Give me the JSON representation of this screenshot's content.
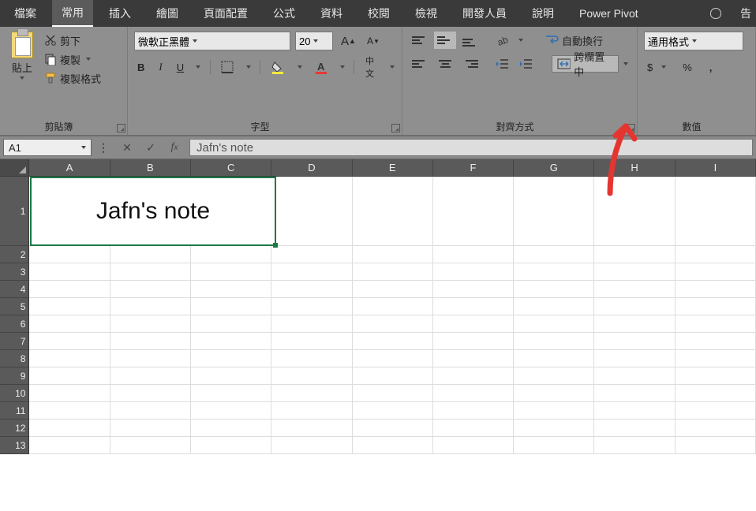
{
  "menu": {
    "items": [
      "檔案",
      "常用",
      "插入",
      "繪圖",
      "頁面配置",
      "公式",
      "資料",
      "校閱",
      "檢視",
      "開發人員",
      "說明",
      "Power Pivot"
    ],
    "active_index": 1,
    "tell_me_cut": "告"
  },
  "ribbon": {
    "clipboard": {
      "paste": "貼上",
      "cut": "剪下",
      "copy": "複製",
      "format_painter": "複製格式",
      "group_label": "剪貼簿"
    },
    "font": {
      "font_name": "微軟正黑體",
      "font_size": "20",
      "bold": "B",
      "italic": "I",
      "underline": "U",
      "phonetic": "中文",
      "group_label": "字型"
    },
    "alignment": {
      "wrap_text": "自動換行",
      "merge_center": "跨欄置中",
      "group_label": "對齊方式"
    },
    "number": {
      "format_selected": "通用格式",
      "currency": "$",
      "percent": "%",
      "comma": ",",
      "group_label": "數值"
    }
  },
  "formula_bar": {
    "name_box": "A1",
    "formula": "Jafn's note"
  },
  "grid": {
    "columns": [
      "A",
      "B",
      "C",
      "D",
      "E",
      "F",
      "G",
      "H",
      "I"
    ],
    "row_count": 13,
    "merged_cell_text": "Jafn's note"
  }
}
